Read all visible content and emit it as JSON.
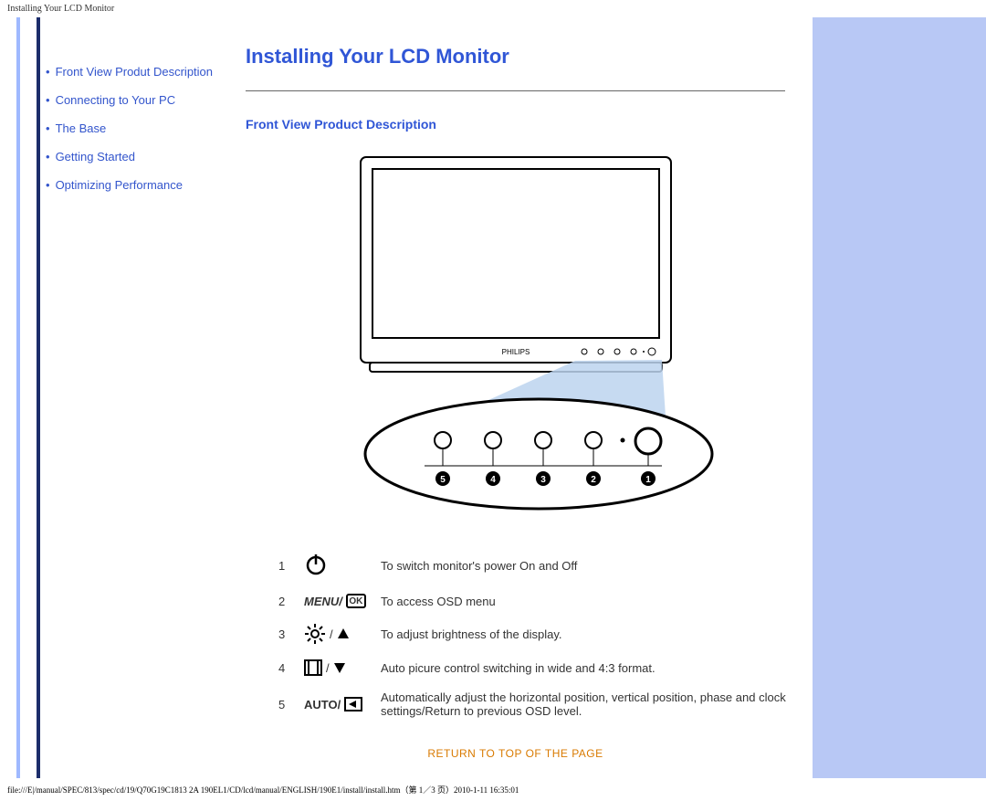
{
  "header_path": "Installing Your LCD Monitor",
  "sidebar": {
    "items": [
      {
        "label": "Front View Produt Description"
      },
      {
        "label": "Connecting to Your PC"
      },
      {
        "label": "The Base"
      },
      {
        "label": "Getting Started"
      },
      {
        "label": "Optimizing Performance"
      }
    ]
  },
  "main": {
    "title": "Installing Your LCD Monitor",
    "subtitle": "Front View Product Description",
    "monitor_brand": "PHILIPS",
    "controls": [
      {
        "num": "1",
        "icon": "power-icon",
        "desc": "To switch monitor's power On and Off"
      },
      {
        "num": "2",
        "icon": "menu-ok-icon",
        "label_left": "MENU/",
        "label_box": "OK",
        "desc": "To access OSD menu"
      },
      {
        "num": "3",
        "icon": "brightness-up-icon",
        "desc": "To adjust brightness of the display."
      },
      {
        "num": "4",
        "icon": "aspect-down-icon",
        "desc": "Auto picure control switching in wide and 4:3 format."
      },
      {
        "num": "5",
        "icon": "auto-back-icon",
        "label_left": "AUTO/",
        "desc": "Automatically adjust the horizontal position, vertical position, phase and clock settings/Return to previous OSD level."
      }
    ],
    "return_link": "RETURN TO TOP OF THE PAGE"
  },
  "footer_path": "file:///E|/manual/SPEC/813/spec/cd/19/Q70G19C1813 2A 190EL1/CD/lcd/manual/ENGLISH/190E1/install/install.htm（第 1／3 页）2010-1-11 16:35:01"
}
